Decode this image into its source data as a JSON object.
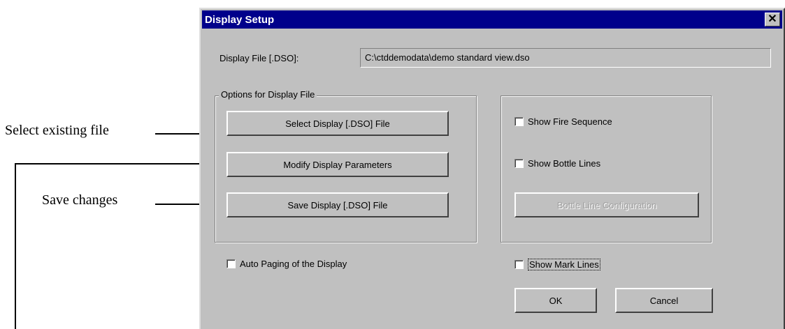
{
  "callouts": {
    "select_existing": "Select existing file",
    "save_changes": "Save changes"
  },
  "dialog": {
    "title": "Display Setup",
    "close_glyph": "✕",
    "file_label": "Display File [.DSO]:",
    "file_value": "C:\\ctddemodata\\demo standard view.dso",
    "options_group_label": "Options for Display File",
    "buttons": {
      "select": "Select Display [.DSO] File",
      "modify": "Modify Display Parameters",
      "save": "Save Display [.DSO] File",
      "bottle_config": "Bottle Line Configuration",
      "ok": "OK",
      "cancel": "Cancel"
    },
    "checkboxes": {
      "fire_sequence": "Show Fire Sequence",
      "bottle_lines": "Show Bottle Lines",
      "auto_paging": "Auto Paging of the Display",
      "mark_lines": "Show Mark Lines"
    },
    "colors": {
      "titlebar": "#00008b",
      "face": "#c0c0c0"
    }
  }
}
